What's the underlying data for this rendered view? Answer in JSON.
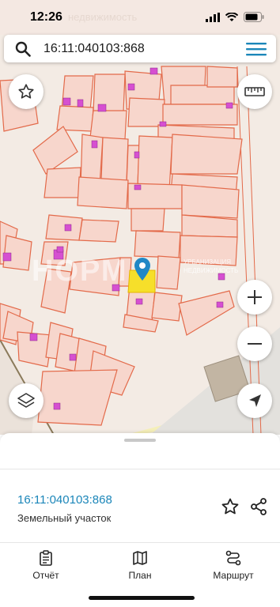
{
  "status_bar": {
    "time": "12:26",
    "watermark": "недвижимость"
  },
  "search": {
    "query": "16:11:040103:868"
  },
  "map": {
    "watermark_left": "НОРМ",
    "watermark_right": "УРБАНИЗАЦИЯ НЕДВИЖИМОСТЬ"
  },
  "parcel": {
    "number": "16:11:040103:868",
    "type": "Земельный участок"
  },
  "tabs": [
    {
      "label": "Отчёт"
    },
    {
      "label": "План"
    },
    {
      "label": "Маршрут"
    }
  ],
  "colors": {
    "parcel_fill": "#f7d6cc",
    "parcel_stroke": "#e36a4a",
    "building": "#d64fd1",
    "selected": "#f6df2a",
    "pin": "#2088c6",
    "accent": "#1b86b9"
  }
}
